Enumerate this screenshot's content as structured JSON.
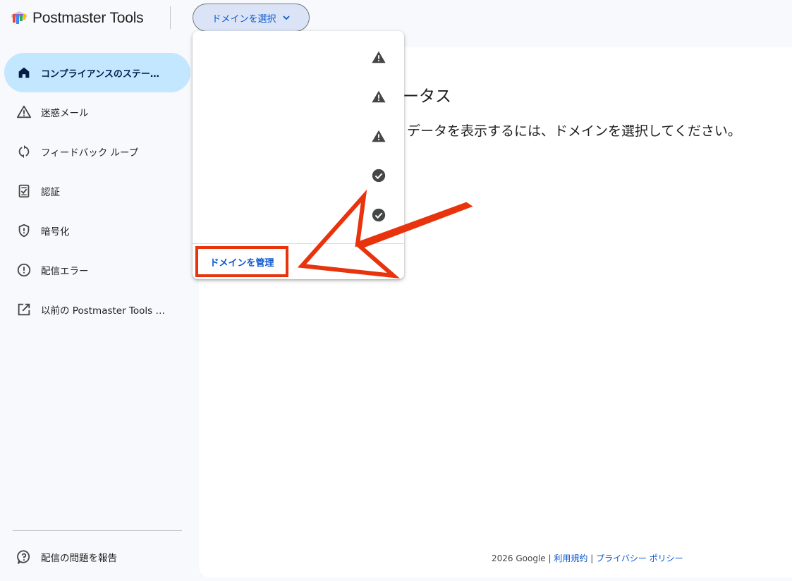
{
  "app": {
    "title": "Postmaster Tools",
    "logo": "postmaster-logo"
  },
  "header": {
    "domain_select_label": "ドメインを選択",
    "domain_select_icon": "chevron-down-icon"
  },
  "sidebar": {
    "items": [
      {
        "label": "コンプライアンスのステー…",
        "icon": "home-icon",
        "active": true
      },
      {
        "label": "迷惑メール",
        "icon": "warning-outline-icon",
        "active": false
      },
      {
        "label": "フィードバック ループ",
        "icon": "sync-icon",
        "active": false
      },
      {
        "label": "認証",
        "icon": "checklist-icon",
        "active": false
      },
      {
        "label": "暗号化",
        "icon": "shield-icon",
        "active": false
      },
      {
        "label": "配信エラー",
        "icon": "error-outline-icon",
        "active": false
      },
      {
        "label": "以前の Postmaster Tools …",
        "icon": "open-in-new-icon",
        "active": false
      }
    ],
    "report_label": "配信の問題を報告",
    "report_icon": "feedback-help-icon"
  },
  "main": {
    "title": "ータス",
    "message": "データを表示するには、ドメインを選択してください。"
  },
  "dropdown": {
    "items": [
      {
        "status": "warning-icon"
      },
      {
        "status": "warning-icon"
      },
      {
        "status": "warning-icon"
      },
      {
        "status": "check-circle-icon"
      },
      {
        "status": "check-circle-icon"
      }
    ],
    "manage_label": "ドメインを管理"
  },
  "footer": {
    "copyright": "2026 Google",
    "separator": "|",
    "terms": "利用規約",
    "privacy": "プライバシー ポリシー"
  },
  "colors": {
    "accent": "#0b57d0",
    "active_bg": "#c2e7ff",
    "annotation": "#e8330c"
  }
}
